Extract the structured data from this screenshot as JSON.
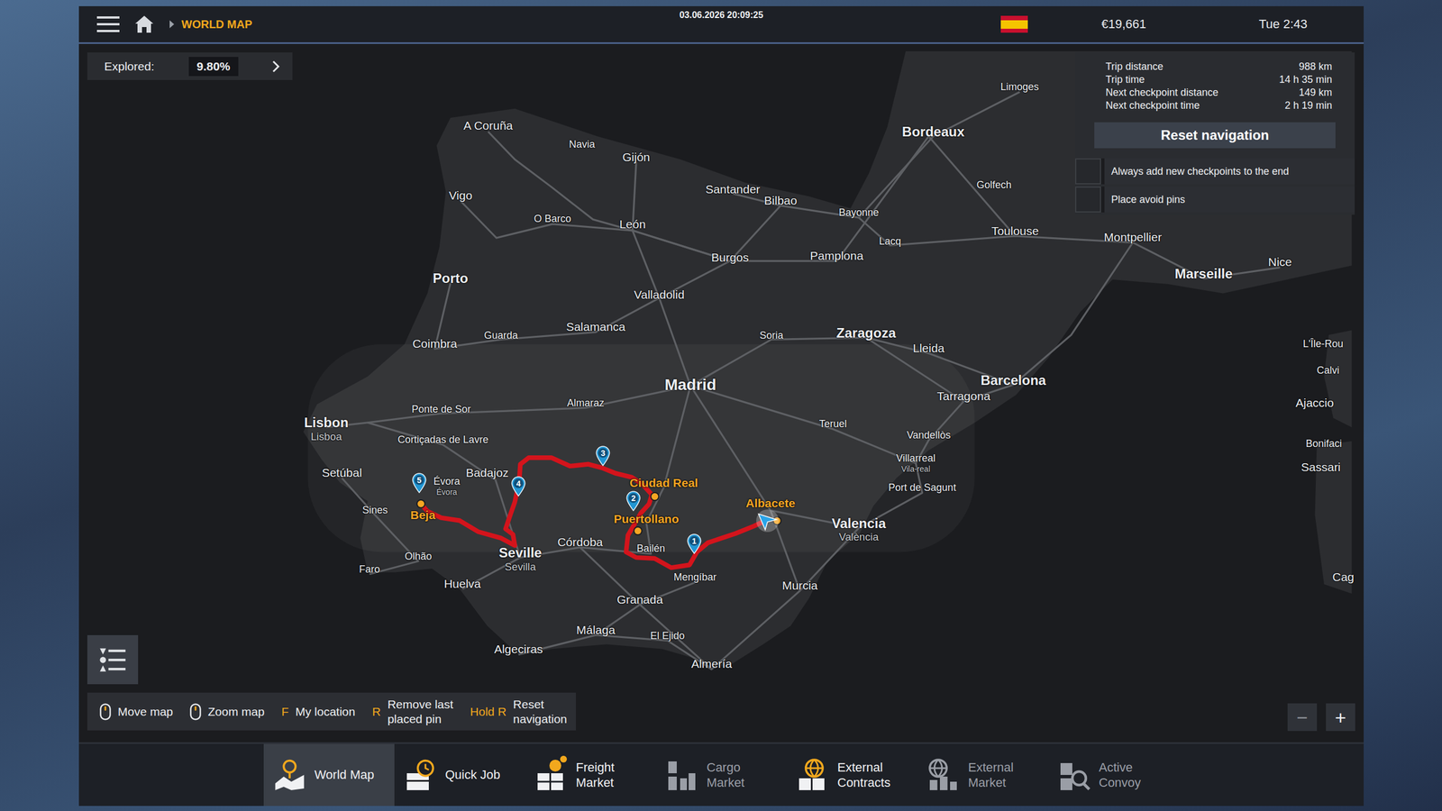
{
  "top_bar": {
    "breadcrumb": "WORLD MAP",
    "datetime": "03.06.2026 20:09:25",
    "money": "€19,661",
    "clock": "Tue 2:43"
  },
  "explored": {
    "label": "Explored:",
    "value": "9.80%"
  },
  "trip_info": {
    "rows": [
      {
        "label": "Trip distance",
        "value": "988 km"
      },
      {
        "label": "Trip time",
        "value": "14 h 35 min"
      },
      {
        "label": "Next checkpoint distance",
        "value": "149 km"
      },
      {
        "label": "Next checkpoint time",
        "value": "2 h 19 min"
      }
    ],
    "button": "Reset navigation",
    "options": [
      {
        "label": "Always add new checkpoints to the end",
        "checked": false
      },
      {
        "label": "Place avoid pins",
        "checked": false
      }
    ]
  },
  "map": {
    "cities": [
      {
        "name": "A Coruña",
        "kind": "city",
        "on_route": false
      },
      {
        "name": "Navia",
        "kind": "town",
        "on_route": false
      },
      {
        "name": "Gijón",
        "kind": "city",
        "on_route": false
      },
      {
        "name": "Vigo",
        "kind": "city",
        "on_route": false
      },
      {
        "name": "O Barco",
        "kind": "town",
        "on_route": false
      },
      {
        "name": "León",
        "kind": "city",
        "on_route": false
      },
      {
        "name": "Santander",
        "kind": "city",
        "on_route": false
      },
      {
        "name": "Bilbao",
        "kind": "city",
        "on_route": false
      },
      {
        "name": "Bayonne",
        "kind": "town",
        "on_route": false
      },
      {
        "name": "Bordeaux",
        "kind": "big",
        "on_route": false
      },
      {
        "name": "Limoges",
        "kind": "town",
        "on_route": false
      },
      {
        "name": "Golfech",
        "kind": "town",
        "on_route": false
      },
      {
        "name": "Lacq",
        "kind": "town",
        "on_route": false
      },
      {
        "name": "Toulouse",
        "kind": "city",
        "on_route": false
      },
      {
        "name": "Montpellier",
        "kind": "city",
        "on_route": false
      },
      {
        "name": "Marseille",
        "kind": "big",
        "on_route": false
      },
      {
        "name": "Nice",
        "kind": "city",
        "on_route": false
      },
      {
        "name": "Porto",
        "kind": "big",
        "on_route": false
      },
      {
        "name": "Burgos",
        "kind": "city",
        "on_route": false
      },
      {
        "name": "Pamplona",
        "kind": "city",
        "on_route": false
      },
      {
        "name": "Valladolid",
        "kind": "city",
        "on_route": false
      },
      {
        "name": "Salamanca",
        "kind": "city",
        "on_route": false
      },
      {
        "name": "Soria",
        "kind": "town",
        "on_route": false
      },
      {
        "name": "Zaragoza",
        "kind": "big",
        "on_route": false
      },
      {
        "name": "Lleida",
        "kind": "city",
        "on_route": false
      },
      {
        "name": "Coimbra",
        "kind": "city",
        "on_route": false
      },
      {
        "name": "Guarda",
        "kind": "town",
        "on_route": false
      },
      {
        "name": "Madrid",
        "kind": "capital",
        "on_route": false
      },
      {
        "name": "Barcelona",
        "kind": "big",
        "on_route": false
      },
      {
        "name": "Tarragona",
        "kind": "city",
        "on_route": false
      },
      {
        "name": "L'Île-Rou",
        "kind": "town",
        "on_route": false
      },
      {
        "name": "Calvi",
        "kind": "town",
        "on_route": false
      },
      {
        "name": "Ajaccio",
        "kind": "city",
        "on_route": false
      },
      {
        "name": "Bonifaci",
        "kind": "town",
        "on_route": false
      },
      {
        "name": "Sassari",
        "kind": "city",
        "on_route": false
      },
      {
        "name": "Cag",
        "kind": "city",
        "on_route": false
      },
      {
        "name": "Lisbon",
        "alt": "Lisboa",
        "kind": "big",
        "on_route": false
      },
      {
        "name": "Ponte de Sor",
        "kind": "town",
        "on_route": false
      },
      {
        "name": "Almaraz",
        "kind": "town",
        "on_route": false
      },
      {
        "name": "Teruel",
        "kind": "town",
        "on_route": false
      },
      {
        "name": "Vandellòs",
        "kind": "town",
        "on_route": false
      },
      {
        "name": "Cortiçadas de Lavre",
        "kind": "town",
        "on_route": false
      },
      {
        "name": "Villarreal",
        "alt": "Vila-real",
        "kind": "town",
        "on_route": false
      },
      {
        "name": "Port de Sagunt",
        "kind": "town",
        "on_route": false
      },
      {
        "name": "Setúbal",
        "kind": "city",
        "on_route": false
      },
      {
        "name": "Évora",
        "alt": "Évora",
        "kind": "town",
        "on_route": false
      },
      {
        "name": "Badajoz",
        "kind": "city",
        "on_route": false
      },
      {
        "name": "Ciudad Real",
        "kind": "city",
        "on_route": true
      },
      {
        "name": "Valencia",
        "alt": "València",
        "kind": "big",
        "on_route": false
      },
      {
        "name": "Albacete",
        "kind": "city",
        "on_route": true
      },
      {
        "name": "Puertollano",
        "kind": "city",
        "on_route": true
      },
      {
        "name": "Sines",
        "kind": "town",
        "on_route": false
      },
      {
        "name": "Beja",
        "kind": "city",
        "on_route": true
      },
      {
        "name": "Córdoba",
        "kind": "city",
        "on_route": false
      },
      {
        "name": "Bailén",
        "kind": "town",
        "on_route": false
      },
      {
        "name": "Seville",
        "alt": "Sevilla",
        "kind": "big",
        "on_route": false
      },
      {
        "name": "Olhão",
        "kind": "town",
        "on_route": false
      },
      {
        "name": "Faro",
        "kind": "town",
        "on_route": false
      },
      {
        "name": "Huelva",
        "kind": "city",
        "on_route": false
      },
      {
        "name": "Mengíbar",
        "kind": "town",
        "on_route": false
      },
      {
        "name": "Murcia",
        "kind": "city",
        "on_route": false
      },
      {
        "name": "Granada",
        "kind": "city",
        "on_route": false
      },
      {
        "name": "Málaga",
        "kind": "city",
        "on_route": false
      },
      {
        "name": "El Ejido",
        "kind": "town",
        "on_route": false
      },
      {
        "name": "Algeciras",
        "kind": "city",
        "on_route": false
      },
      {
        "name": "Almería",
        "kind": "city",
        "on_route": false
      }
    ],
    "checkpoints": [
      {
        "label": "1"
      },
      {
        "label": "2"
      },
      {
        "label": "3"
      },
      {
        "label": "4"
      },
      {
        "label": "5"
      }
    ]
  },
  "hints": [
    {
      "kind": "mouse",
      "lines": [
        "Move map"
      ]
    },
    {
      "kind": "mouse",
      "lines": [
        "Zoom map"
      ]
    },
    {
      "kind": "key",
      "key": "F",
      "lines": [
        "My location"
      ]
    },
    {
      "kind": "key",
      "key": "R",
      "lines": [
        "Remove last",
        "placed pin"
      ]
    },
    {
      "kind": "key",
      "key": "Hold R",
      "lines": [
        "Reset",
        "navigation"
      ]
    }
  ],
  "zoom": {
    "out": "−",
    "in": "+"
  },
  "nav": [
    {
      "lines": [
        "World Map"
      ],
      "selected": true,
      "disabled": false,
      "badge": false
    },
    {
      "lines": [
        "Quick Job"
      ],
      "selected": false,
      "disabled": false,
      "badge": false
    },
    {
      "lines": [
        "Freight",
        "Market"
      ],
      "selected": false,
      "disabled": false,
      "badge": true
    },
    {
      "lines": [
        "Cargo",
        "Market"
      ],
      "selected": false,
      "disabled": true,
      "badge": false
    },
    {
      "lines": [
        "External",
        "Contracts"
      ],
      "selected": false,
      "disabled": false,
      "badge": false
    },
    {
      "lines": [
        "External",
        "Market"
      ],
      "selected": false,
      "disabled": true,
      "badge": false
    },
    {
      "lines": [
        "Active",
        "Convoy"
      ],
      "selected": false,
      "disabled": true,
      "badge": false
    }
  ]
}
